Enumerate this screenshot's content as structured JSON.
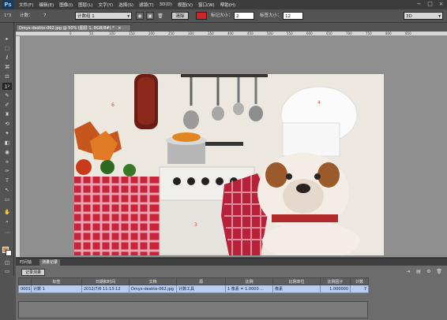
{
  "app": {
    "logo": "Ps"
  },
  "menu": [
    "文件(F)",
    "编辑(E)",
    "图像(I)",
    "图层(L)",
    "文字(Y)",
    "选择(S)",
    "滤镜(T)",
    "3D(D)",
    "视图(V)",
    "窗口(W)",
    "帮助(H)"
  ],
  "window_controls": {
    "minimize": "−",
    "maximize": "□",
    "close": "×"
  },
  "options": {
    "tool_glyph": "1²3",
    "count_label": "计数：",
    "count_value": "7",
    "group_select": "计数组 1",
    "clear_button": "清除",
    "marker_color": "#d0232a",
    "marker_size_label": "标记大小：",
    "marker_size_value": "2",
    "label_size_label": "标签大小：",
    "label_size_value": "12",
    "workspace": "3D"
  },
  "document": {
    "tab_title": "Dmyx-deskto-062.jpg @ 50% (图层 1, RGB/8#) *",
    "tab_close": "×",
    "ruler_ticks": [
      "0",
      "50",
      "100",
      "150",
      "200",
      "250",
      "300",
      "350",
      "400",
      "450",
      "500",
      "550",
      "600",
      "650",
      "700",
      "750",
      "800",
      "850"
    ],
    "count_markers": [
      "6",
      "4",
      "3"
    ]
  },
  "tools": [
    "▸",
    "⬚",
    "ℓ",
    "⌘",
    "⊡",
    "✎",
    "⊕",
    "✐",
    "♜",
    "⟲",
    "✦",
    "◧",
    "◉",
    "⟡",
    "✑",
    "T",
    "↖",
    "▭",
    "✋",
    "⌕"
  ],
  "panel": {
    "tabs": [
      "时间轴",
      "测量记录"
    ],
    "record_button": "记录测量",
    "icons": [
      "export-icon",
      "filter-icon",
      "settings-icon",
      "delete-icon"
    ],
    "headers": [
      "",
      "标签",
      "日期和时间",
      "文档",
      "源",
      "比例",
      "比例单位",
      "比例因子",
      "计数"
    ],
    "rows": [
      [
        "0001",
        "计数 1",
        "2012/7/6 11:13:12",
        "Dmyx-deskto-062.jpg",
        "计数工具",
        "1 像素 = 1.0000 ...",
        "像素",
        "1.000000",
        "7"
      ]
    ]
  }
}
